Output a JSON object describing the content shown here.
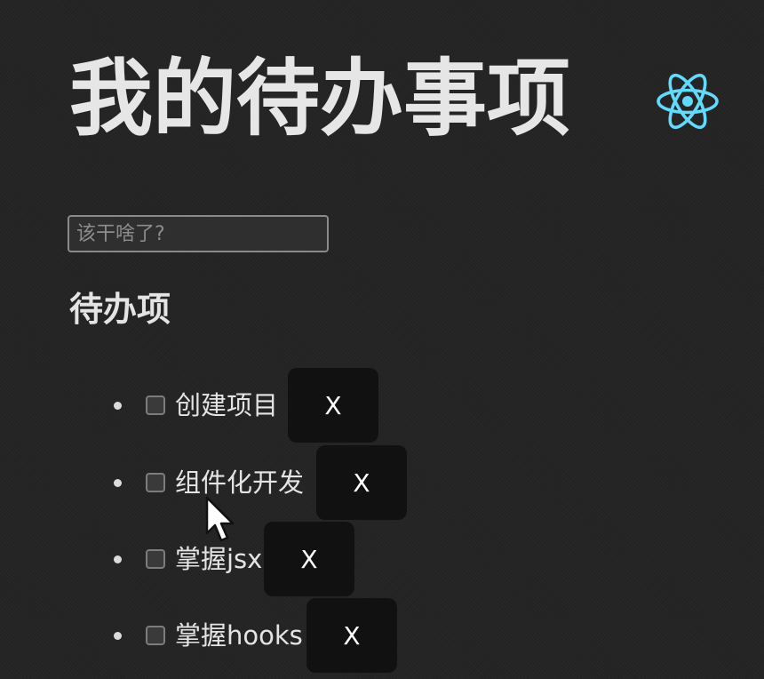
{
  "header": {
    "title": "我的待办事项",
    "logo_icon": "react-icon",
    "logo_color": "#61dafb"
  },
  "input": {
    "placeholder": "该干啥了?",
    "value": ""
  },
  "section": {
    "heading": "待办项"
  },
  "todos": [
    {
      "label": "创建项目",
      "checked": false,
      "delete_label": "X"
    },
    {
      "label": "组件化开发",
      "checked": false,
      "delete_label": "X"
    },
    {
      "label": "掌握jsx",
      "checked": false,
      "delete_label": "X"
    },
    {
      "label": "掌握hooks",
      "checked": false,
      "delete_label": "X"
    }
  ],
  "colors": {
    "background": "#242424",
    "text": "#e4e4e4",
    "button_bg": "#111111",
    "react_accent": "#61dafb"
  }
}
